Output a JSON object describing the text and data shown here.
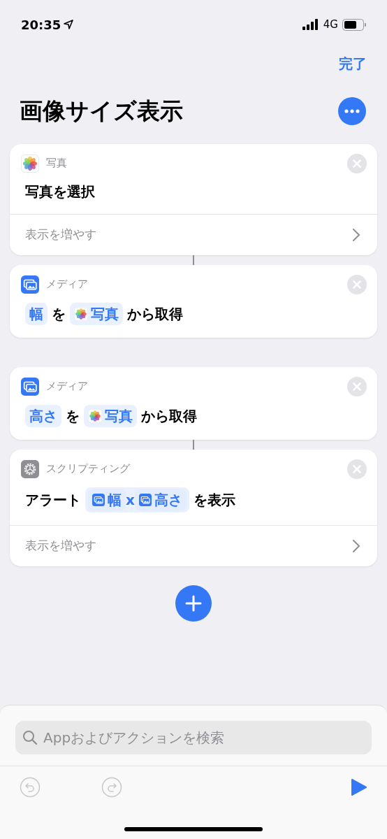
{
  "status_bar": {
    "time": "20:35",
    "network": "4G"
  },
  "nav": {
    "done": "完了"
  },
  "title": "画像サイズ表示",
  "actions": [
    {
      "kind": "photos",
      "category": "写真",
      "parts": [
        {
          "kind": "text",
          "text": "写真を選択"
        }
      ],
      "more": "表示を増やす",
      "connector_below": true
    },
    {
      "kind": "media",
      "category": "メディア",
      "parts": [
        {
          "kind": "token",
          "text": "幅"
        },
        {
          "kind": "text",
          "text": "を"
        },
        {
          "kind": "photo_token",
          "text": "写真"
        },
        {
          "kind": "text",
          "text": "から取得"
        }
      ],
      "connector_below": false
    },
    {
      "kind": "media",
      "category": "メディア",
      "parts": [
        {
          "kind": "token",
          "text": "高さ"
        },
        {
          "kind": "text",
          "text": "を"
        },
        {
          "kind": "photo_token",
          "text": "写真"
        },
        {
          "kind": "text",
          "text": "から取得"
        }
      ],
      "connector_below": true
    },
    {
      "kind": "scripting",
      "category": "スクリプティング",
      "parts": [
        {
          "kind": "text",
          "text": "アラート"
        },
        {
          "kind": "group",
          "items": [
            {
              "kind": "media_token",
              "text": "幅"
            },
            {
              "kind": "sep",
              "text": "x"
            },
            {
              "kind": "media_token",
              "text": "高さ"
            }
          ]
        },
        {
          "kind": "text",
          "text": "を表示"
        }
      ],
      "more": "表示を増やす"
    }
  ],
  "search": {
    "placeholder": "Appおよびアクションを検索"
  },
  "toolbar": {
    "undo_disabled": true,
    "redo_disabled": true
  }
}
